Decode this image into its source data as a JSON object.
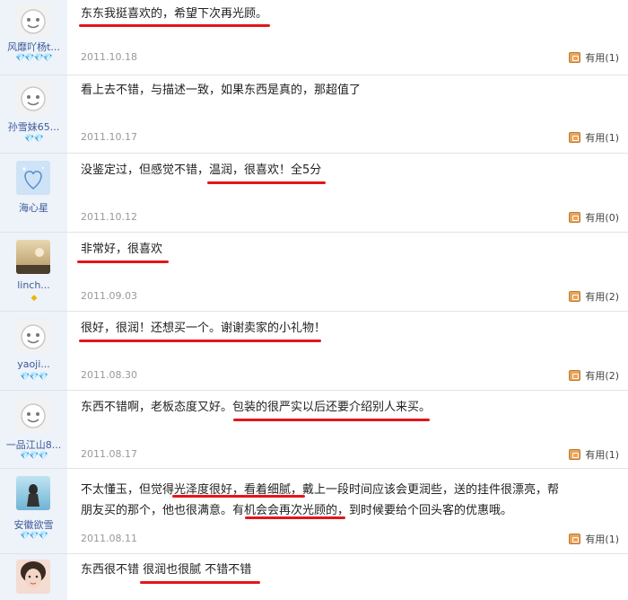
{
  "reviews": [
    {
      "user": "风靡吖杨t...",
      "rank": "💎💎💎💎",
      "comment": "东东我挺喜欢的，希望下次再光顾。",
      "date": "2011.10.18",
      "useful": "有用(1)"
    },
    {
      "user": "孙雪妹65...",
      "rank": "💎💎",
      "comment": "看上去不错，与描述一致，如果东西是真的，那超值了",
      "date": "2011.10.17",
      "useful": "有用(1)"
    },
    {
      "user": "海心星",
      "rank": "",
      "comment": "没鉴定过，但感觉不错，温润，很喜欢！全5分",
      "date": "2011.10.12",
      "useful": "有用(0)"
    },
    {
      "user": "linch...",
      "rank": "◆",
      "comment": "非常好，很喜欢",
      "date": "2011.09.03",
      "useful": "有用(2)"
    },
    {
      "user": "yaoji...",
      "rank": "💎💎💎",
      "comment": "很好，很润！还想买一个。谢谢卖家的小礼物！",
      "date": "2011.08.30",
      "useful": "有用(2)"
    },
    {
      "user": "一品江山8...",
      "rank": "💎💎💎",
      "comment": "东西不错啊，老板态度又好。包装的很严实以后还要介绍别人来买。",
      "date": "2011.08.17",
      "useful": "有用(1)"
    },
    {
      "user": "安徽欲雪",
      "rank": "💎💎💎",
      "comment_lines": [
        "不太懂玉，但觉得光泽度很好，看着细腻，戴上一段时间应该会更润些，送的挂件很漂亮，帮",
        "朋友买的那个，他也很满意。有机会会再次光顾的，到时候要给个回头客的优惠哦。"
      ],
      "date": "2011.08.11",
      "useful": "有用(1)"
    },
    {
      "user": "",
      "rank": "",
      "comment": "东西很不错 很润也很腻 不错不错",
      "date": "",
      "useful": ""
    }
  ]
}
